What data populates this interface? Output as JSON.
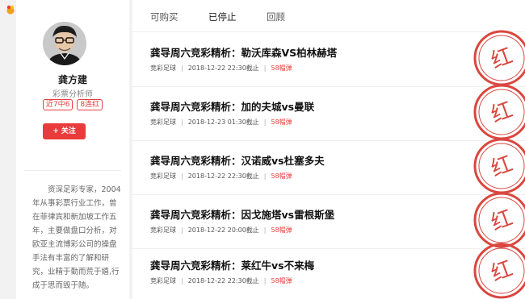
{
  "sidebar": {
    "author_name": "龚方建",
    "author_title": "彩票分析师",
    "badges": [
      "近7中6",
      "8连红"
    ],
    "follow_label": "关注",
    "follow_icon": "plus-icon",
    "bio": "资深足彩专家，2004年从事彩票行业工作，曾在菲律宾和新加坡工作五年，主要做盘口分析，对欧亚主流博彩公司的操盘手法有丰富的了解和研究，业精于勤而荒于嬉,行成于思而毁于随。"
  },
  "tabs": [
    {
      "label": "可购买",
      "active": false
    },
    {
      "label": "已停止",
      "active": true
    },
    {
      "label": "回顾",
      "active": false
    }
  ],
  "articles": [
    {
      "title": "龚导周六竞彩精析：勒沃库森VS柏林赫塔",
      "category": "竞彩足球",
      "deadline": "2018-12-22 22:30截止",
      "price": "58帽弹",
      "stamp": "红"
    },
    {
      "title": "龚导周六竞彩精析：加的夫城vs曼联",
      "category": "竞彩足球",
      "deadline": "2018-12-23 01:30截止",
      "price": "58帽弹",
      "stamp": "红"
    },
    {
      "title": "龚导周六竞彩精析：汉诺威vs杜塞多夫",
      "category": "竞彩足球",
      "deadline": "2018-12-22 22:30截止",
      "price": "58帽弹",
      "stamp": "红"
    },
    {
      "title": "龚导周六竞彩精析：因戈施塔vs雷根斯堡",
      "category": "竞彩足球",
      "deadline": "2018-12-22 20:00截止",
      "price": "58帽弹",
      "stamp": "红"
    },
    {
      "title": "龚导周六竞彩精析：莱红牛vs不来梅",
      "category": "竞彩足球",
      "deadline": "2018-12-22 22:30截止",
      "price": "58帽弹",
      "stamp": "红"
    }
  ],
  "colors": {
    "accent": "#e93b3b",
    "stamp": "#d9473f"
  }
}
